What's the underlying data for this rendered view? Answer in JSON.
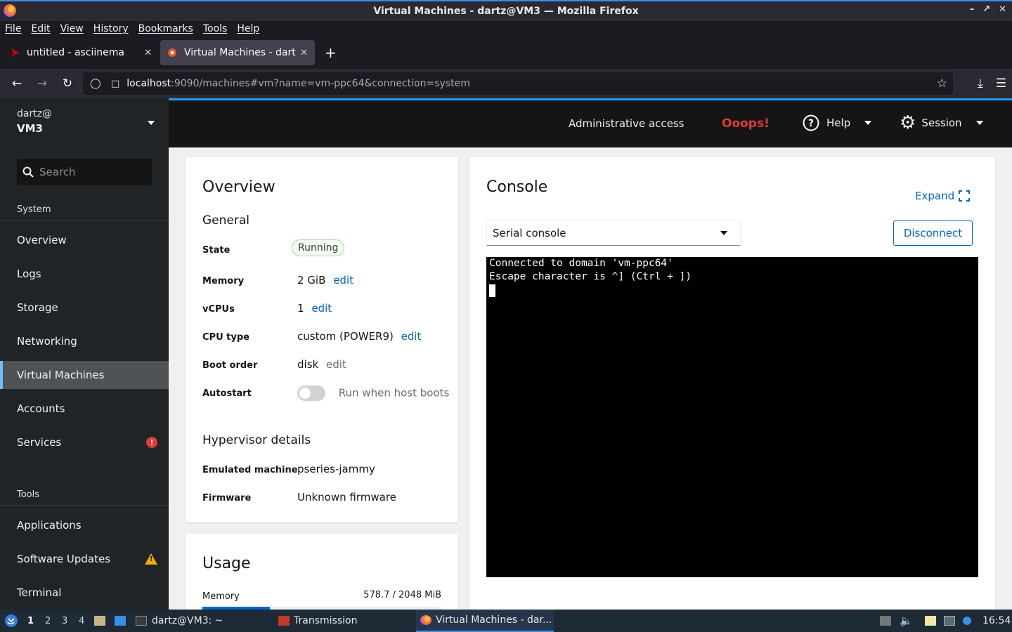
{
  "window": {
    "title": "Virtual Machines - dartz@VM3 — Mozilla Firefox"
  },
  "menubar": [
    "File",
    "Edit",
    "View",
    "History",
    "Bookmarks",
    "Tools",
    "Help"
  ],
  "tabs": [
    {
      "title": "untitled - asciinema",
      "active": false
    },
    {
      "title": "Virtual Machines - dartz@",
      "active": true
    }
  ],
  "navbar": {
    "url_host": "localhost",
    "url_path": ":9090/machines#vm?name=vm-ppc64&connection=system"
  },
  "sidebar": {
    "user": "dartz@",
    "host": "VM3",
    "search_placeholder": "Search",
    "system_label": "System",
    "system_items": [
      "Overview",
      "Logs",
      "Storage",
      "Networking",
      "Virtual Machines",
      "Accounts",
      "Services"
    ],
    "tools_label": "Tools",
    "tools_items": [
      "Applications",
      "Software Updates",
      "Terminal"
    ],
    "active": "Virtual Machines",
    "colors": {
      "danger": "#e03a3a",
      "warning": "#f0ab00",
      "active_accent": "#73bcf7"
    }
  },
  "masthead": {
    "admin": "Administrative access",
    "oops": "Ooops!",
    "help": "Help",
    "session": "Session"
  },
  "overview": {
    "title": "Overview",
    "general_title": "General",
    "state_label": "State",
    "state_value": "Running",
    "memory_label": "Memory",
    "memory_value": "2 GiB",
    "vcpus_label": "vCPUs",
    "vcpus_value": "1",
    "cpu_type_label": "CPU type",
    "cpu_type_value": "custom (POWER9)",
    "boot_order_label": "Boot order",
    "boot_order_value": "disk",
    "autostart_label": "Autostart",
    "autostart_text": "Run when host boots",
    "edit": "edit",
    "hypervisor_title": "Hypervisor details",
    "emulated_label": "Emulated machine",
    "emulated_value": "pseries-jammy",
    "firmware_label": "Firmware",
    "firmware_value": "Unknown firmware"
  },
  "usage": {
    "title": "Usage",
    "memory_label": "Memory",
    "memory_value": "578.7 / 2048 MiB",
    "memory_fraction": 0.283
  },
  "console": {
    "title": "Console",
    "expand": "Expand",
    "select_value": "Serial console",
    "disconnect": "Disconnect",
    "lines": [
      "Connected to domain 'vm-ppc64'",
      "Escape character is ^] (Ctrl + ])"
    ]
  },
  "taskbar": {
    "workspaces": [
      "1",
      "2",
      "3",
      "4"
    ],
    "terminal": "dartz@VM3: ~",
    "transmission": "Transmission",
    "firefox": "Virtual Machines - dar...",
    "clock": "16:54"
  }
}
